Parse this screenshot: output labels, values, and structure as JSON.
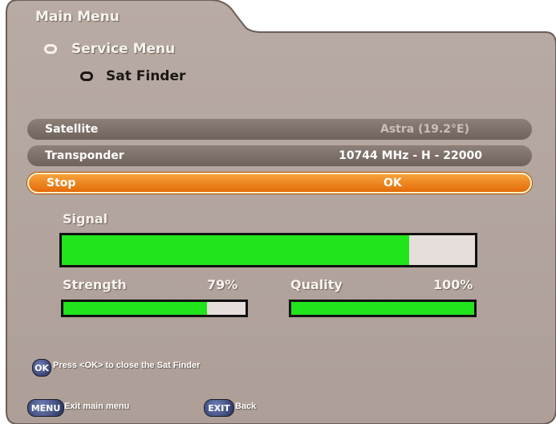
{
  "breadcrumb": {
    "title": "Main Menu",
    "level1": "Service Menu",
    "level2": "Sat Finder"
  },
  "rows": {
    "satellite": {
      "label": "Satellite",
      "value": "Astra (19.2°E)"
    },
    "transponder": {
      "label": "Transponder",
      "value": "10744 MHz - H - 22000"
    },
    "stop": {
      "label": "Stop",
      "value": "OK"
    }
  },
  "signal": {
    "label": "Signal",
    "level": 0.84
  },
  "strength": {
    "label": "Strength",
    "value": "79%",
    "level": 0.79
  },
  "quality": {
    "label": "Quality",
    "value": "100%",
    "level": 1.0
  },
  "hints": {
    "ok_button": "OK",
    "ok_text": "Press <OK> to close the Sat Finder",
    "menu_button": "MENU",
    "menu_text": "Exit main menu",
    "exit_button": "EXIT",
    "exit_text": "Back"
  },
  "colors": {
    "panel": "#b3a69e",
    "highlight": "#f28a1e",
    "bar_green": "#22e41c"
  }
}
